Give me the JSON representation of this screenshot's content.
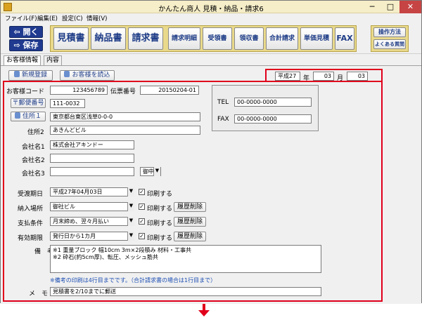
{
  "window": {
    "title": "かんたん商人 見積・納品・請求6",
    "min_glyph": "─",
    "max_glyph": "□",
    "close_glyph": "✕"
  },
  "menu": [
    "ファイル(F)",
    "編集(E)",
    "設定(C)",
    "情報(V)"
  ],
  "toolbar": {
    "open_label": "開く",
    "save_label": "保存",
    "big_buttons": [
      "見積書",
      "納品書",
      "請求書"
    ],
    "small_buttons": [
      "請求明細",
      "受領書",
      "領収書",
      "合計請求",
      "単価見積"
    ],
    "fax_label": "FAX",
    "manual_label": "操作方法",
    "faq_label": "よくある質問"
  },
  "tabs": [
    "お客様情報",
    "内容"
  ],
  "form": {
    "new_reg_label": "新規登録",
    "load_customer_label": "お客様を読込",
    "era": "平成27",
    "year_label": "年",
    "month_value": "03",
    "month_label": "月",
    "day_value": "03",
    "customer_code_label": "お客様コード",
    "customer_code": "123456789",
    "slip_no_label": "伝票番号",
    "slip_no": "20150204-01",
    "postal_btn_label": "郵便番号",
    "postal": "111-0032",
    "address1_btn_label": "住所１",
    "address1": "東京都台東区浅草0-0-0",
    "address2_label": "住所2",
    "address2": "あきんどビル",
    "company1_label": "会社名1",
    "company1": "株式会社アキンドー",
    "company2_label": "会社名2",
    "company2": "",
    "company3_label": "会社名3",
    "company3": "",
    "honorific": "御中",
    "tel_label": "TEL",
    "tel": "00-0000-0000",
    "fax_label": "FAX",
    "fax": "00-0000-0000",
    "delivery_deadline_label": "受渡期日",
    "delivery_deadline": "平成27年04月03日",
    "delivery_place_label": "納入場所",
    "delivery_place": "御社ビル",
    "payment_terms_label": "支払条件",
    "payment_terms": "月末締め、翌々月払い",
    "valid_period_label": "有効期限",
    "valid_period": "発行日から1カ月",
    "print_label": "印刷する",
    "history_clear_label": "履歴削除",
    "notes_label": "備　考",
    "notes_line1": "※1 重量ブロック 幅10cm 3m×2段積み 材料・工事共",
    "notes_line2": "※2 砕石(約5cm厚)、転圧、メッシュ筋共",
    "notes_help": "※備考の印刷は4行目までです。（合計請求書の場合は1行目まで）",
    "memo_label": "メ　モ",
    "memo": "見積書を2/10までに郵送"
  },
  "colors": {
    "accent_blue": "#1e3c87",
    "highlight_red": "#e0001b",
    "toolbar_group": "#e9d98a"
  }
}
